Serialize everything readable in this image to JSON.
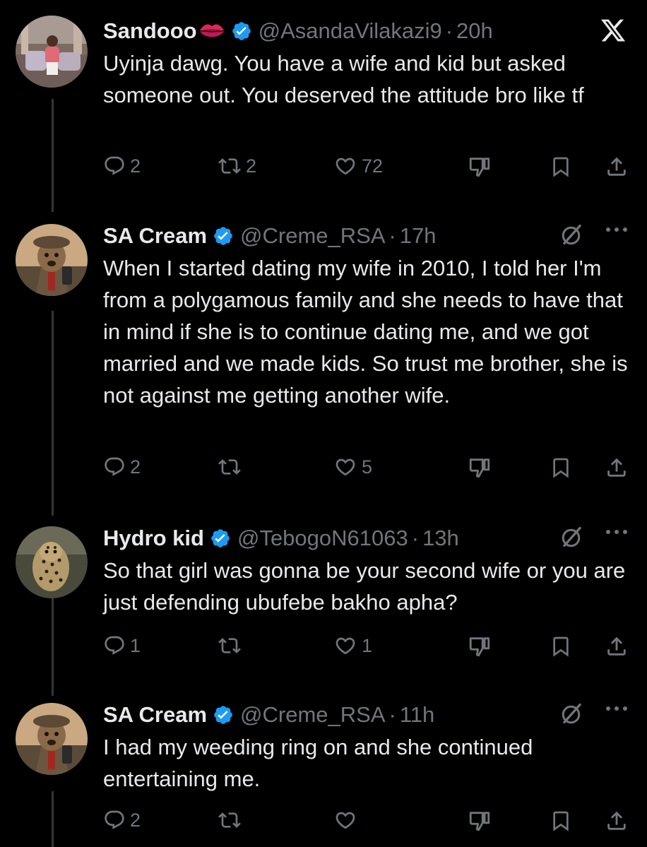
{
  "colors": {
    "background": "#000000",
    "text_primary": "#e7e9ea",
    "text_secondary": "#71767b",
    "verified_blue": "#1d9bf0",
    "thread_line": "#333639"
  },
  "tweets": [
    {
      "name": "Sandooo",
      "name_emoji": "lips",
      "handle": "@AsandaVilakazi9",
      "separator": "·",
      "time": "20h",
      "text": "Uyinja dawg. You have a wife and kid but asked someone out. You deserved the attitude bro like tf",
      "reply_count": "2",
      "retweet_count": "2",
      "like_count": "72",
      "top_right_icon": "x-logo-icon"
    },
    {
      "name": "SA Cream",
      "handle": "@Creme_RSA",
      "separator": "·",
      "time": "17h",
      "text": "When I started dating my wife in 2010, I told her I'm from a polygamous family and she needs to have that in mind if she is to continue dating me, and we got married and we made kids. So trust me brother, she is not against me getting another wife.",
      "reply_count": "2",
      "retweet_count": "",
      "like_count": "5",
      "top_right_icon": "grok-icon"
    },
    {
      "name": "Hydro kid",
      "handle": "@TebogoN61063",
      "separator": "·",
      "time": "13h",
      "text": "So that girl was gonna be your second wife or you are just defending ubufebe bakho apha?",
      "reply_count": "1",
      "retweet_count": "",
      "like_count": "1",
      "top_right_icon": "grok-icon"
    },
    {
      "name": "SA Cream",
      "handle": "@Creme_RSA",
      "separator": "·",
      "time": "11h",
      "text": "I had my weeding ring on and she continued entertaining me.",
      "reply_count": "2",
      "retweet_count": "",
      "like_count": "",
      "top_right_icon": "grok-icon"
    }
  ]
}
